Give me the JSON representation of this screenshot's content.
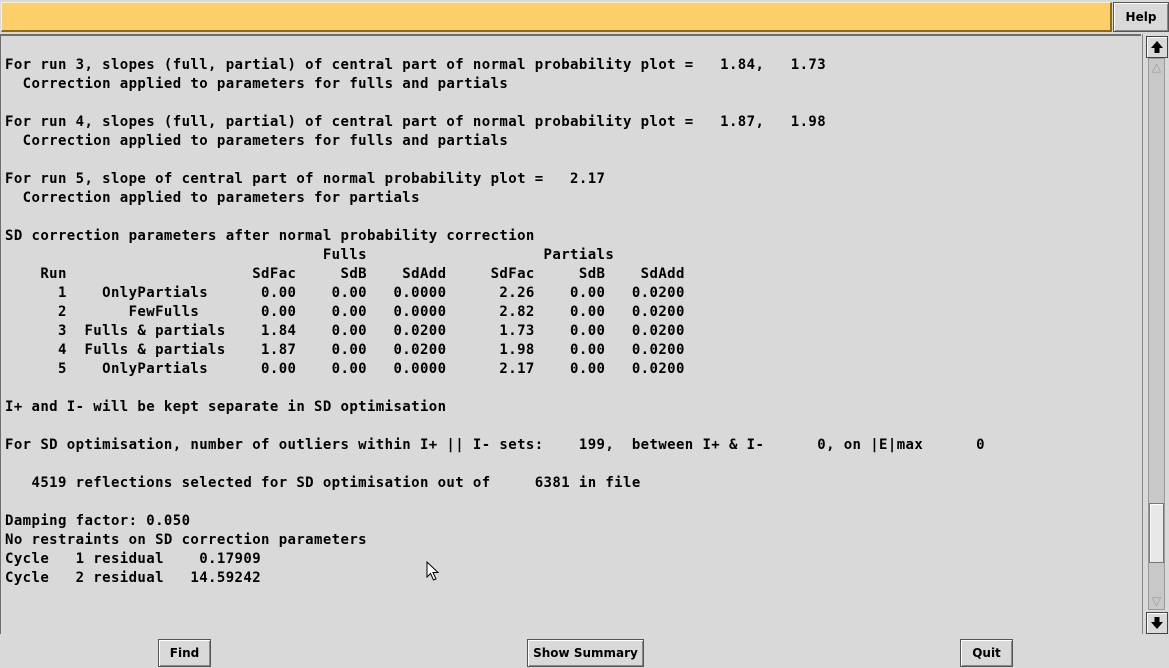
{
  "header": {
    "help_label": "Help"
  },
  "log_lines": [
    "For run 3, slopes (full, partial) of central part of normal probability plot =   1.84,   1.73",
    "  Correction applied to parameters for fulls and partials",
    "",
    "For run 4, slopes (full, partial) of central part of normal probability plot =   1.87,   1.98",
    "  Correction applied to parameters for fulls and partials",
    "",
    "For run 5, slope of central part of normal probability plot =   2.17",
    "  Correction applied to parameters for partials",
    "",
    "SD correction parameters after normal probability correction",
    "                                    Fulls                    Partials",
    "    Run                     SdFac     SdB    SdAdd     SdFac     SdB    SdAdd",
    "      1    OnlyPartials      0.00    0.00   0.0000      2.26    0.00   0.0200",
    "      2       FewFulls       0.00    0.00   0.0000      2.82    0.00   0.0200",
    "      3  Fulls & partials    1.84    0.00   0.0200      1.73    0.00   0.0200",
    "      4  Fulls & partials    1.87    0.00   0.0200      1.98    0.00   0.0200",
    "      5    OnlyPartials      0.00    0.00   0.0000      2.17    0.00   0.0200",
    "",
    "I+ and I- will be kept separate in SD optimisation",
    "",
    "For SD optimisation, number of outliers within I+ || I- sets:    199,  between I+ & I-      0, on |E|max      0",
    "",
    "   4519 reflections selected for SD optimisation out of     6381 in file",
    "",
    "Damping factor: 0.050",
    "No restraints on SD correction parameters",
    "Cycle   1 residual    0.17909",
    "Cycle   2 residual   14.59242"
  ],
  "scroll": {
    "up_icon": "arrow-up-icon",
    "down_icon": "arrow-down-icon",
    "position_fraction": 0.93
  },
  "footer": {
    "find_label": "Find",
    "summary_label": "Show Summary",
    "quit_label": "Quit"
  }
}
